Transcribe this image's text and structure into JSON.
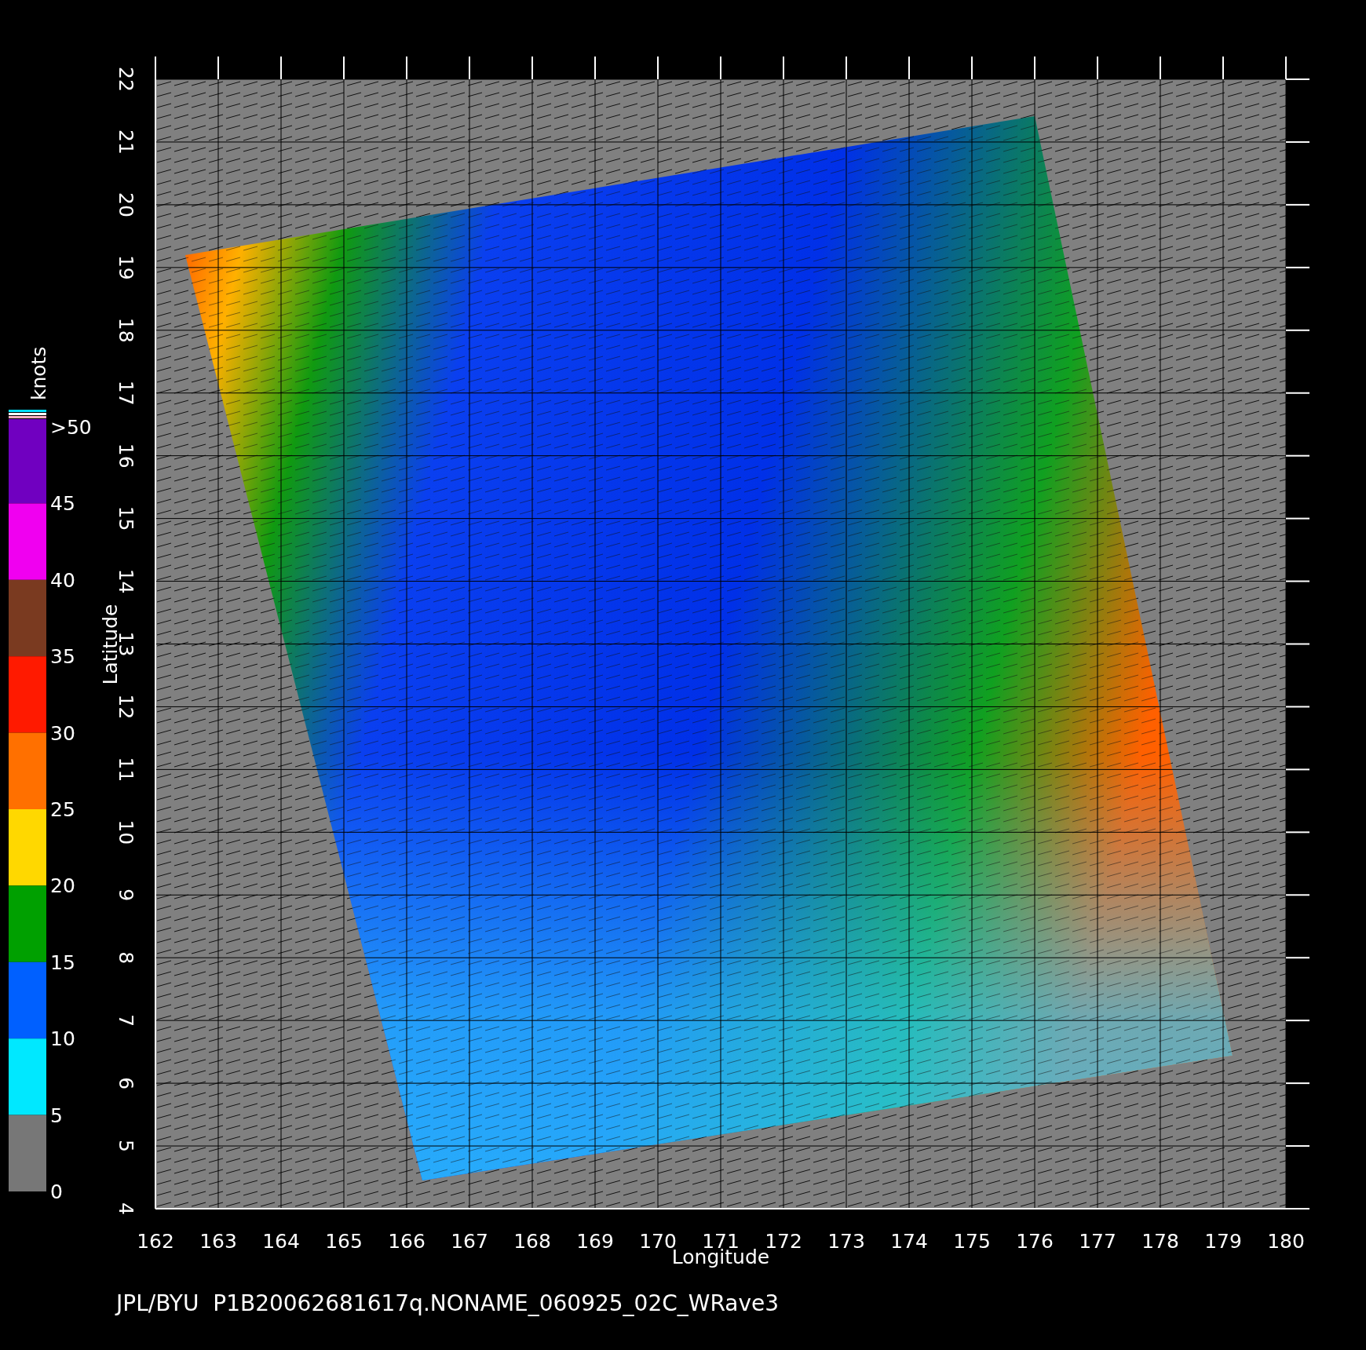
{
  "map": {
    "x_axis": {
      "label": "Longitude",
      "ticks": [
        "162",
        "163",
        "164",
        "165",
        "166",
        "167",
        "168",
        "169",
        "170",
        "171",
        "172",
        "173",
        "174",
        "175",
        "176",
        "177",
        "178",
        "179",
        "180"
      ]
    },
    "y_axis": {
      "label": "Latitude",
      "ticks": [
        "4",
        "5",
        "6",
        "7",
        "8",
        "9",
        "10",
        "11",
        "12",
        "13",
        "14",
        "15",
        "16",
        "17",
        "18",
        "19",
        "20",
        "21",
        "22"
      ]
    }
  },
  "colorbar": {
    "unit": "knots",
    "labels": [
      ">50",
      "45",
      "40",
      "35",
      "30",
      "25",
      "20",
      "15",
      "10",
      "5",
      "0"
    ],
    "bands": [
      {
        "color": "#7000c0"
      },
      {
        "color": "#f000f0"
      },
      {
        "color": "#7a3a20"
      },
      {
        "color": "#ff1a00"
      },
      {
        "color": "#ff7000"
      },
      {
        "color": "#ffd800"
      },
      {
        "color": "#00a000"
      },
      {
        "color": "#0060ff"
      },
      {
        "color": "#00e8ff"
      },
      {
        "color": "#777777"
      }
    ]
  },
  "caption": "JPL/BYU  P1B20062681617q.NONAME_060925_02C_WRave3"
}
